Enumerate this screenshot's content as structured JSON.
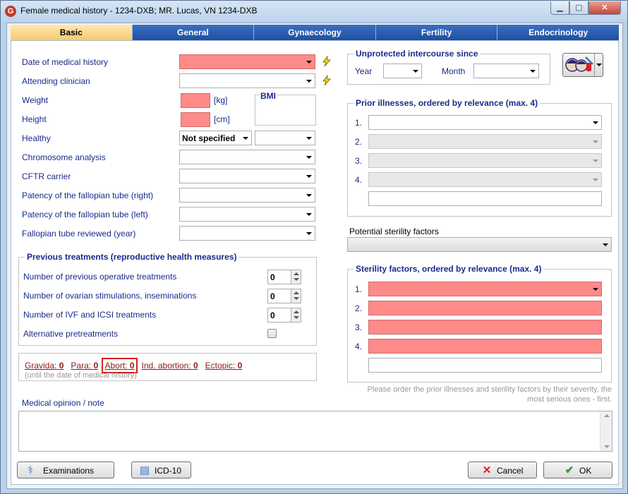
{
  "window": {
    "title": "Female medical history - 1234-DXB; MR. Lucas, VN 1234-DXB",
    "icon": "G"
  },
  "tabs": [
    "Basic",
    "General",
    "Gynaecology",
    "Fertility",
    "Endocrinology"
  ],
  "left": {
    "date_label": "Date of medical history",
    "clinician_label": "Attending clinician",
    "weight_label": "Weight",
    "weight_unit": "[kg]",
    "height_label": "Height",
    "height_unit": "[cm]",
    "bmi_label": "BMI",
    "healthy_label": "Healthy",
    "healthy_value": "Not specified",
    "chromosome_label": "Chromosome analysis",
    "cftr_label": "CFTR carrier",
    "patency_right_label": "Patency of the fallopian tube (right)",
    "patency_left_label": "Patency of the fallopian tube (left)",
    "reviewed_label": "Fallopian tube reviewed (year)"
  },
  "prev": {
    "title": "Previous treatments (reproductive health measures)",
    "operative_label": "Number of previous operative treatments",
    "operative_value": "0",
    "ovarian_label": "Number of ovarian stimulations, inseminations",
    "ovarian_value": "0",
    "ivf_label": "Number of IVF and ICSI treatments",
    "ivf_value": "0",
    "alt_label": "Alternative pretreatments"
  },
  "gravida": {
    "gravida_label": "Gravida:",
    "gravida_value": "0",
    "para_label": "Para:",
    "para_value": "0",
    "abort_label": "Abort:",
    "abort_value": "0",
    "ind_label": "Ind. abortion:",
    "ind_value": "0",
    "ectopic_label": "Ectopic:",
    "ectopic_value": "0",
    "hint": "(until the date of medical history)"
  },
  "note_label": "Medical opinion / note",
  "right": {
    "unprotected_title": "Unprotected intercourse since",
    "year_label": "Year",
    "month_label": "Month",
    "prior_title": "Prior illnesses, ordered by relevance (max. 4)",
    "potential_label": "Potential sterility factors",
    "sterility_title": "Sterility factors, ordered by relevance (max. 4)",
    "order_hint_1": "Please order the prior illnesses and sterility factors by their severity, the",
    "order_hint_2": "most serious ones - first.",
    "nums": [
      "1.",
      "2.",
      "3.",
      "4."
    ]
  },
  "buttons": {
    "examinations": "Examinations",
    "icd": "ICD-10",
    "cancel": "Cancel",
    "ok": "OK"
  },
  "colors": {
    "required": "#ff8a8a",
    "tab_active": "#f6c96e",
    "tab": "#1f4f9e",
    "label": "#1a2a8a",
    "link": "#8b1a1a",
    "highlight": "#d62020"
  }
}
